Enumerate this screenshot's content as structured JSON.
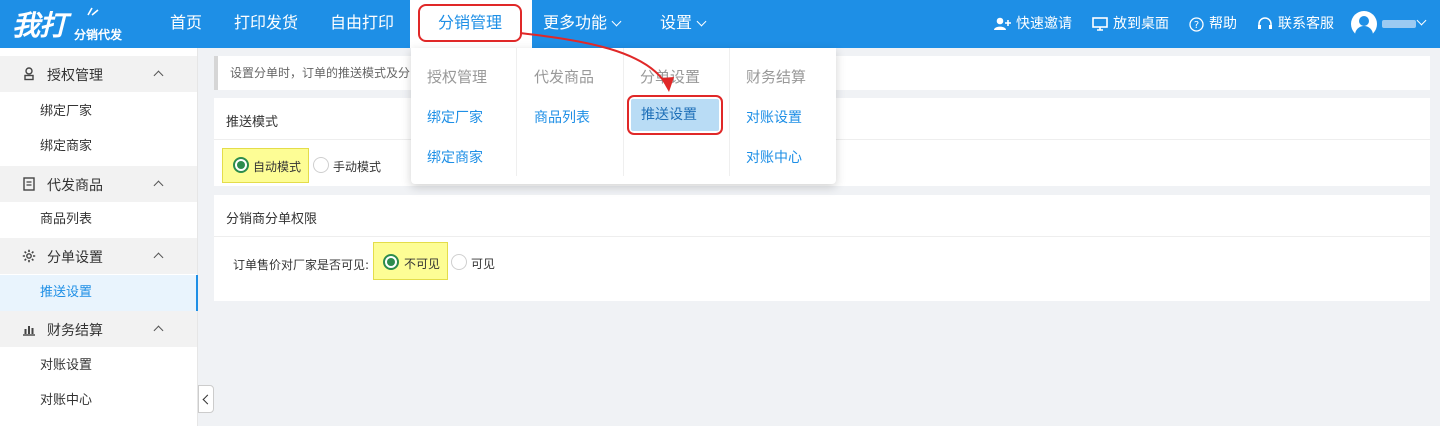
{
  "brand": {
    "main": "我打",
    "sub": "分销代发"
  },
  "nav": {
    "home": "首页",
    "print_ship": "打印发货",
    "free_print": "自由打印",
    "distribution": "分销管理",
    "more": "更多功能",
    "settings": "设置"
  },
  "right_nav": {
    "invite": "快速邀请",
    "desktop": "放到桌面",
    "help": "帮助",
    "contact": "联系客服"
  },
  "sidebar": {
    "groups": [
      {
        "label": "授权管理",
        "items": [
          "绑定厂家",
          "绑定商家"
        ]
      },
      {
        "label": "代发商品",
        "items": [
          "商品列表"
        ]
      },
      {
        "label": "分单设置",
        "items": [
          "推送设置"
        ]
      },
      {
        "label": "财务结算",
        "items": [
          "对账设置",
          "对账中心"
        ]
      }
    ]
  },
  "notice": "设置分单时，订单的推送模式及分",
  "push_mode": {
    "title": "推送模式",
    "auto": "自动模式",
    "manual": "手动模式",
    "selected": "auto"
  },
  "permission": {
    "title": "分销商分单权限",
    "question": "订单售价对厂家是否可见:",
    "invisible": "不可见",
    "visible": "可见",
    "selected": "invisible"
  },
  "dropdown": {
    "columns": [
      {
        "header": "授权管理",
        "items": [
          "绑定厂家",
          "绑定商家"
        ]
      },
      {
        "header": "代发商品",
        "items": [
          "商品列表"
        ]
      },
      {
        "header": "分单设置",
        "items": [
          "推送设置"
        ]
      },
      {
        "header": "财务结算",
        "items": [
          "对账设置",
          "对账中心"
        ]
      }
    ]
  },
  "colors": {
    "primary": "#1e8fe6",
    "highlight_red": "#e02828",
    "radio_green": "#2c8c4d",
    "yellow_highlight": "#fdfd95"
  }
}
